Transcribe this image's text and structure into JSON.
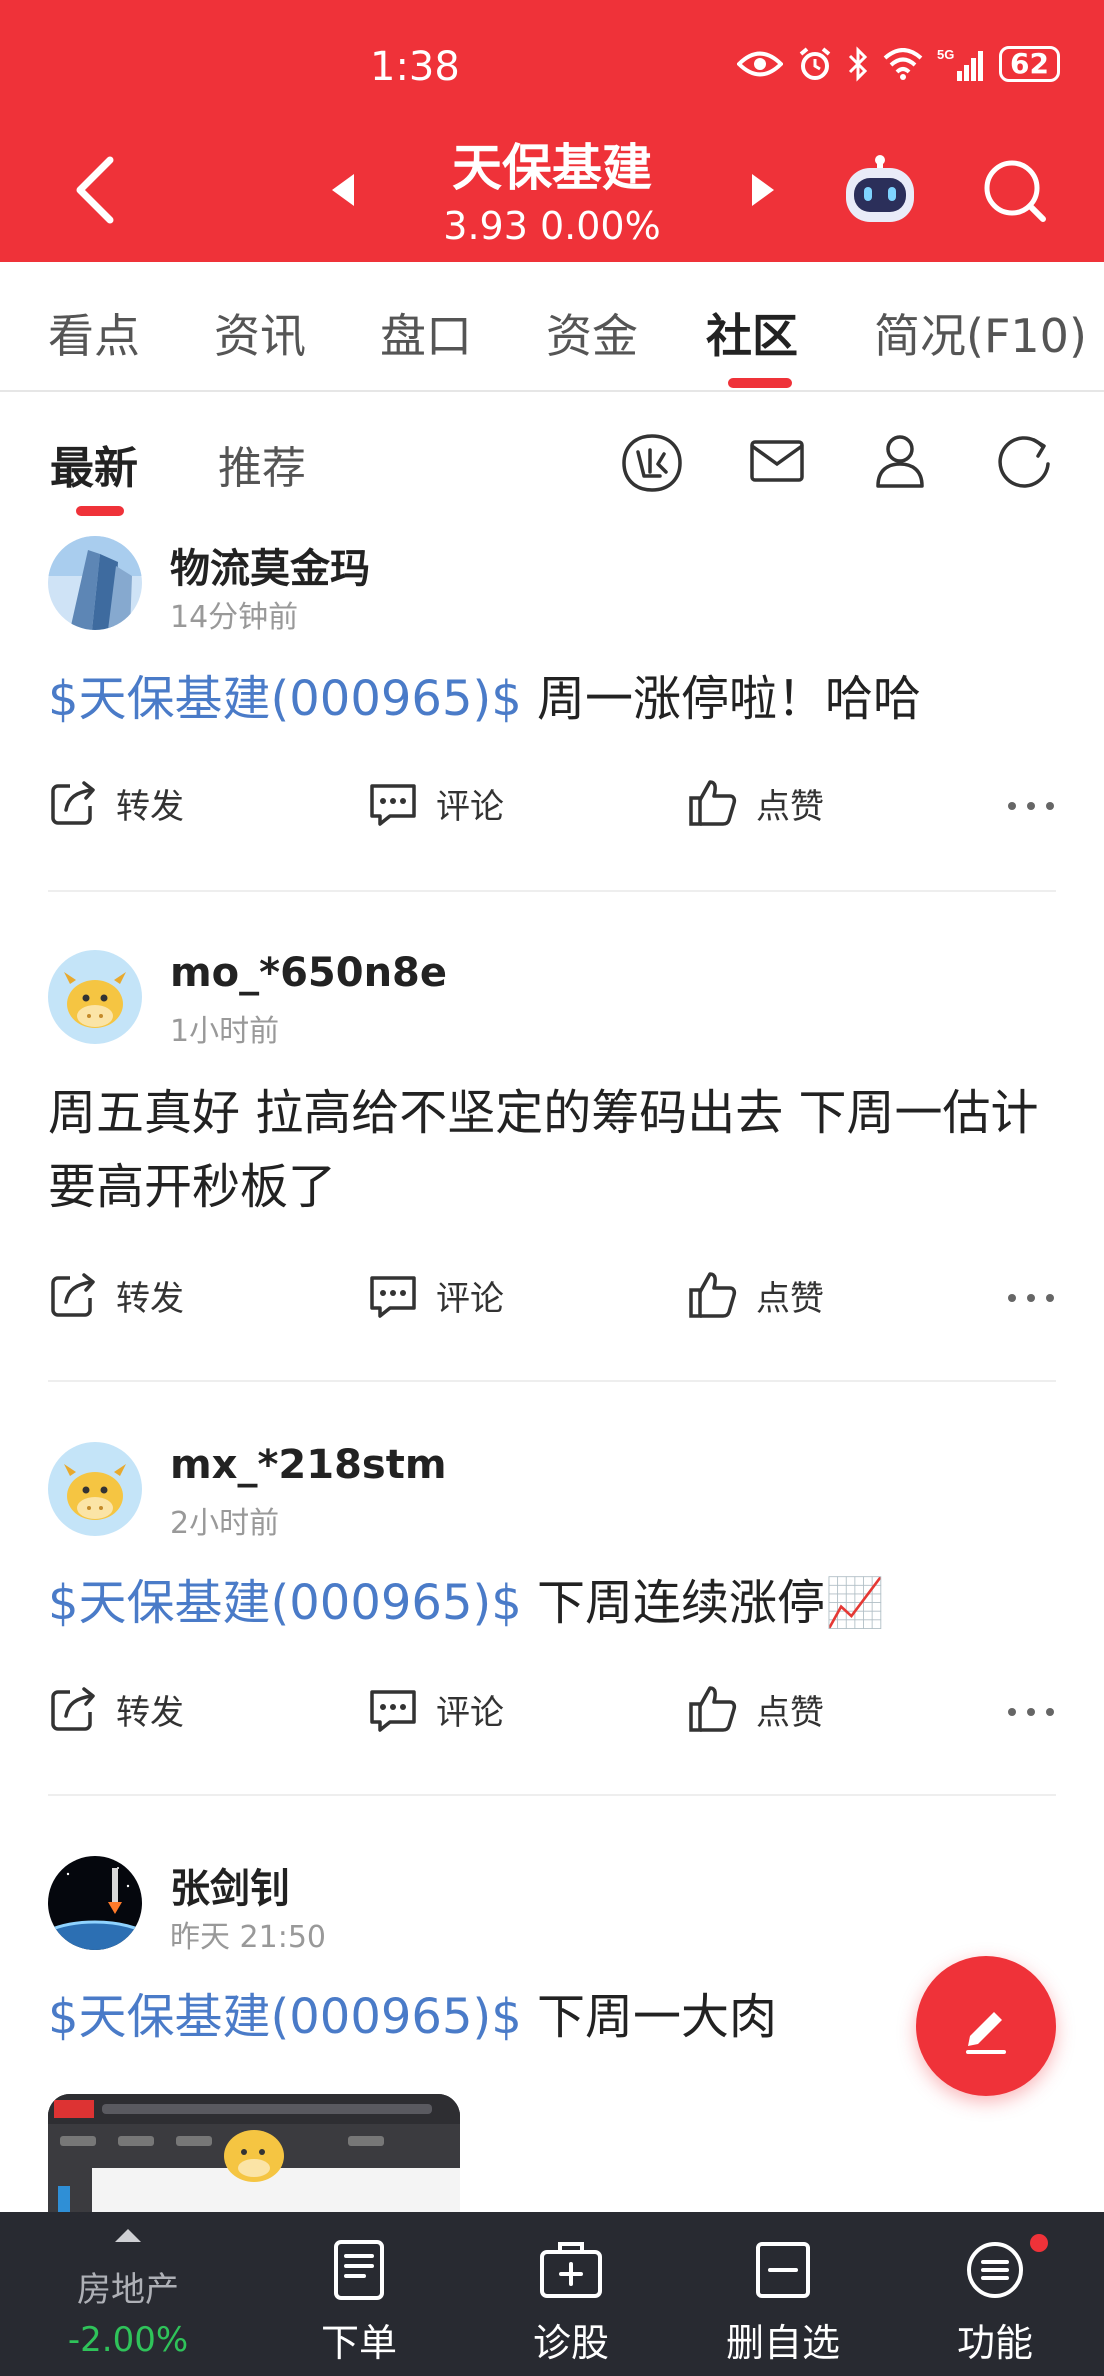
{
  "status_bar": {
    "time": "1:38",
    "battery": "62"
  },
  "header": {
    "stock_name": "天保基建",
    "stock_price": "3.93 0.00%"
  },
  "main_tabs": [
    {
      "label": "看点"
    },
    {
      "label": "资讯"
    },
    {
      "label": "盘口"
    },
    {
      "label": "资金"
    },
    {
      "label": "社区",
      "active": true
    },
    {
      "label": "简况(F10)"
    }
  ],
  "sub_tabs": [
    {
      "label": "最新",
      "active": true
    },
    {
      "label": "推荐"
    }
  ],
  "actions": {
    "forward": "转发",
    "comment": "评论",
    "like": "点赞"
  },
  "posts": [
    {
      "username": "物流莫金玛",
      "time": "14分钟前",
      "tag": "$天保基建(000965)$",
      "text": " 周一涨停啦！哈哈"
    },
    {
      "username": "mo_*650n8e",
      "time": "1小时前",
      "tag": "",
      "text": "周五真好 拉高给不坚定的筹码出去 下周一估计要高开秒板了"
    },
    {
      "username": "mx_*218stm",
      "time": "2小时前",
      "tag": "$天保基建(000965)$",
      "text": " 下周连续涨停📈"
    },
    {
      "username": "张剑钊",
      "time": "昨天 21:50",
      "tag": "$天保基建(000965)$",
      "text": " 下周一大肉"
    }
  ],
  "bottom_bar": {
    "sector_name": "房地产",
    "sector_change": "-2.00%",
    "items": [
      {
        "label": "下单"
      },
      {
        "label": "诊股"
      },
      {
        "label": "删自选"
      },
      {
        "label": "功能"
      }
    ]
  },
  "colors": {
    "brand_red": "#ef3239",
    "tag_blue": "#4a7bc8",
    "down_green": "#2fc35a"
  }
}
